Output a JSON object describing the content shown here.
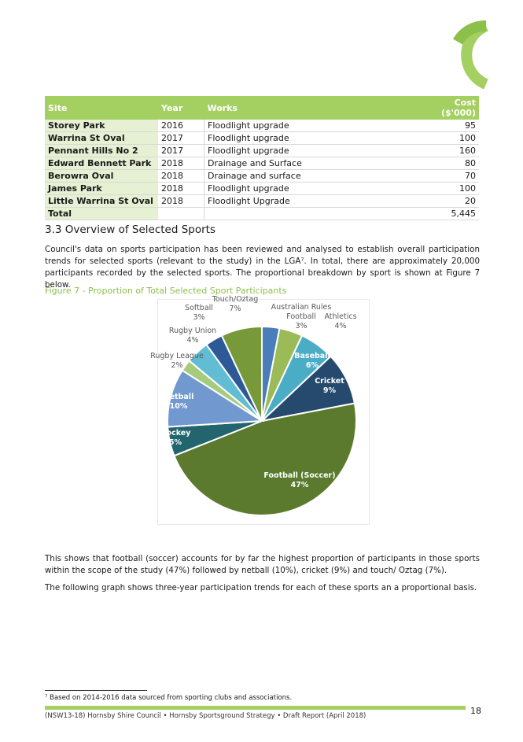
{
  "table": {
    "headers": [
      "Site",
      "Year",
      "Works",
      "Cost ($'000)"
    ],
    "rows": [
      [
        "Storey Park",
        "2016",
        "Floodlight upgrade",
        "95"
      ],
      [
        "Warrina St Oval",
        "2017",
        "Floodlight upgrade",
        "100"
      ],
      [
        "Pennant Hills No 2",
        "2017",
        "Floodlight upgrade",
        "160"
      ],
      [
        "Edward Bennett Park",
        "2018",
        "Drainage and Surface",
        "80"
      ],
      [
        "Berowra Oval",
        "2018",
        "Drainage and surface",
        "70"
      ],
      [
        "James Park",
        "2018",
        "Floodlight upgrade",
        "100"
      ],
      [
        "Little Warrina St Oval",
        "2018",
        "Floodlight Upgrade",
        "20"
      ]
    ],
    "total": {
      "label": "Total",
      "value": "5,445"
    }
  },
  "section": {
    "heading": "3.3   Overview of Selected Sports",
    "para1": "Council's data on sports participation has been reviewed and analysed to establish overall participation trends for selected sports (relevant to the study) in the LGA⁷. In total, there are approximately 20,000 participants recorded by the selected sports. The proportional breakdown by sport is shown at Figure 7 below.",
    "figure_caption": "Figure 7 - Proportion of Total Selected Sport Participants",
    "para2": "This shows that football (soccer) accounts for by far the highest proportion of participants in those sports within the scope of the study (47%) followed by netball (10%), cricket (9%) and touch/ Oztag (7%).",
    "para3": "The following graph shows three-year participation trends for each of these sports an a proportional basis."
  },
  "chart_data": {
    "type": "pie",
    "start": "top",
    "direction": "clockwise",
    "slices": [
      {
        "label": "Australian Rules Football",
        "value": 3,
        "color": "#4a7ebb"
      },
      {
        "label": "Athletics",
        "value": 4,
        "color": "#9bbb59"
      },
      {
        "label": "Baseball",
        "value": 6,
        "color": "#4bacc6"
      },
      {
        "label": "Cricket",
        "value": 9,
        "color": "#254a6e"
      },
      {
        "label": "Football (Soccer)",
        "value": 47,
        "color": "#5b7a2e"
      },
      {
        "label": "Hockey",
        "value": 5,
        "color": "#23656f"
      },
      {
        "label": "Netball",
        "value": 10,
        "color": "#7299cf"
      },
      {
        "label": "Rugby League",
        "value": 2,
        "color": "#a6cb7d"
      },
      {
        "label": "Rugby Union",
        "value": 4,
        "color": "#62bcd3"
      },
      {
        "label": "Softball",
        "value": 3,
        "color": "#2d5a96"
      },
      {
        "label": "Touch/Oztag",
        "value": 7,
        "color": "#77993a"
      }
    ]
  },
  "footnote": "⁷ Based on 2014-2016 data sourced from sporting clubs and associations.",
  "footer": "(NSW13-18) Hornsby Shire Council • Hornsby Sportsground Strategy • Draft Report (April 2018)",
  "page_number": "18",
  "colors": {
    "accent": "#a4cf61",
    "caption": "#8dc04a"
  }
}
